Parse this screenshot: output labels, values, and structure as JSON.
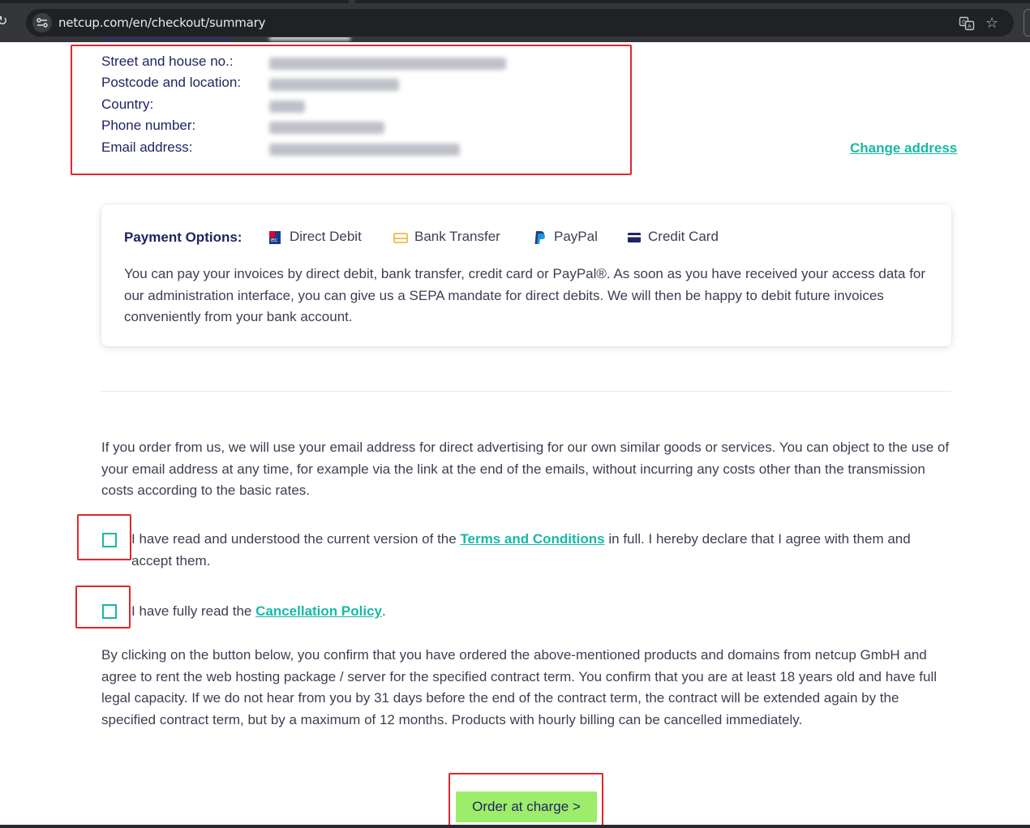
{
  "browser": {
    "url": "netcup.com/en/checkout/summary"
  },
  "address": {
    "rows": [
      {
        "label": "Street and house no.:"
      },
      {
        "label": "Postcode and location:"
      },
      {
        "label": "Country:"
      },
      {
        "label": "Phone number:"
      },
      {
        "label": "Email address:"
      }
    ],
    "change_link": "Change address"
  },
  "payment": {
    "title": "Payment Options:",
    "options": [
      {
        "label": "Direct Debit",
        "icon": "sepa-icon"
      },
      {
        "label": "Bank Transfer",
        "icon": "bank-transfer-icon"
      },
      {
        "label": "PayPal",
        "icon": "paypal-icon"
      },
      {
        "label": "Credit Card",
        "icon": "credit-card-icon"
      }
    ],
    "text": "You can pay your invoices by direct debit, bank transfer, credit card or PayPal®. As soon as you have received your access data for our administration interface, you can give us a SEPA mandate for direct debits. We will then be happy to debit future invoices conveniently from your bank account."
  },
  "advertising_notice": "If you order from us, we will use your email address for direct advertising for our own similar goods or services. You can object to the use of your email address at any time, for example via the link at the end of the emails, without incurring any costs other than the transmission costs according to the basic rates.",
  "consent_terms": {
    "prefix": "I have read and understood the current version of the ",
    "link": "Terms and Conditions",
    "suffix": " in full. I hereby declare that I agree with them and accept them.",
    "checked": false
  },
  "consent_cancellation": {
    "prefix": "I have fully read the ",
    "link": "Cancellation Policy",
    "suffix": ".",
    "checked": false
  },
  "confirmation_text": "By clicking on the button below, you confirm that you have ordered the above-mentioned products and domains from netcup GmbH and agree to rent the web hosting package / server for the specified contract term. You confirm that you are at least 18 years old and have full legal capacity. If we do not hear from you by 31 days before the end of the contract term, the contract will be extended again by the specified contract term, but by a maximum of 12 months. Products with hourly billing can be cancelled immediately.",
  "order_button": "Order at charge >",
  "colors": {
    "accent": "#17b9a6",
    "heading": "#1f2463",
    "button": "#9eed6a",
    "highlight": "#e3262e"
  }
}
